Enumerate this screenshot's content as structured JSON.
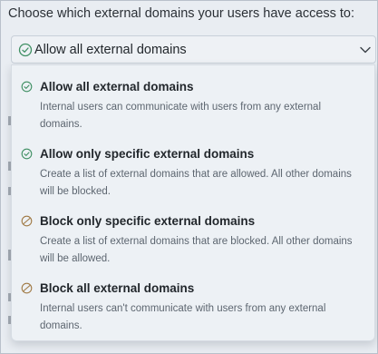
{
  "prompt": "Choose which external domains your users have access to:",
  "select": {
    "value": "Allow all external domains",
    "icon": "check-circle-icon",
    "chevron": "chevron-down-icon"
  },
  "colors": {
    "check_green": "#3f8f63",
    "block_tan": "#a07a45"
  },
  "options": [
    {
      "title": "Allow all external domains",
      "description": "Internal users can communicate with users from any external domains.",
      "icon": "check-circle-icon"
    },
    {
      "title": "Allow only specific external domains",
      "description": "Create a list of external domains that are allowed. All other domains will be blocked.",
      "icon": "check-circle-icon"
    },
    {
      "title": "Block only specific external domains",
      "description": "Create a list of external domains that are blocked. All other domains will be allowed.",
      "icon": "block-icon"
    },
    {
      "title": "Block all external domains",
      "description": "Internal users can't communicate with users from any external domains.",
      "icon": "block-icon"
    }
  ]
}
